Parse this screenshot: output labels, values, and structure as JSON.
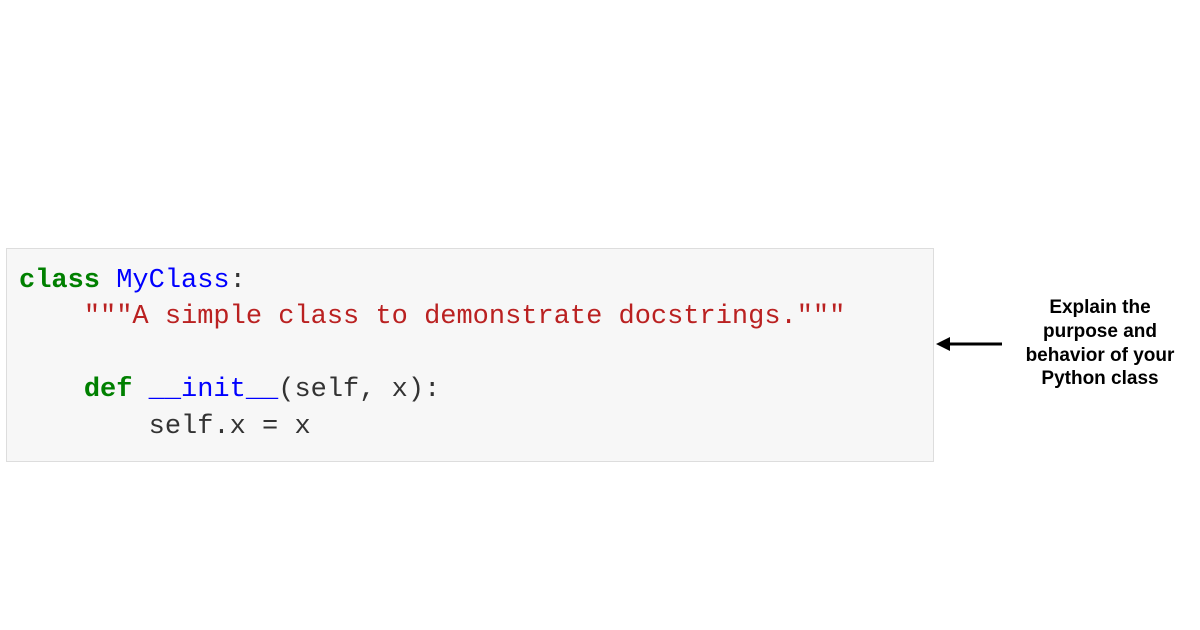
{
  "code": {
    "line1": {
      "kw": "class",
      "space1": " ",
      "name": "MyClass",
      "colon": ":"
    },
    "line2": {
      "indent": "    ",
      "docstring": "\"\"\"A simple class to demonstrate docstrings.\"\"\""
    },
    "line3": "",
    "line4": {
      "indent": "    ",
      "kw": "def",
      "space1": " ",
      "name": "__init__",
      "params": "(self, x):"
    },
    "line5": {
      "indent": "        ",
      "body": "self.x = x"
    }
  },
  "annotation": {
    "text": "Explain the purpose and behavior of your Python class"
  },
  "colors": {
    "keyword": "#008000",
    "classname": "#0000ff",
    "docstring": "#ba2121",
    "plain": "#333333",
    "bg": "#f7f7f7",
    "border": "#dddddd"
  }
}
